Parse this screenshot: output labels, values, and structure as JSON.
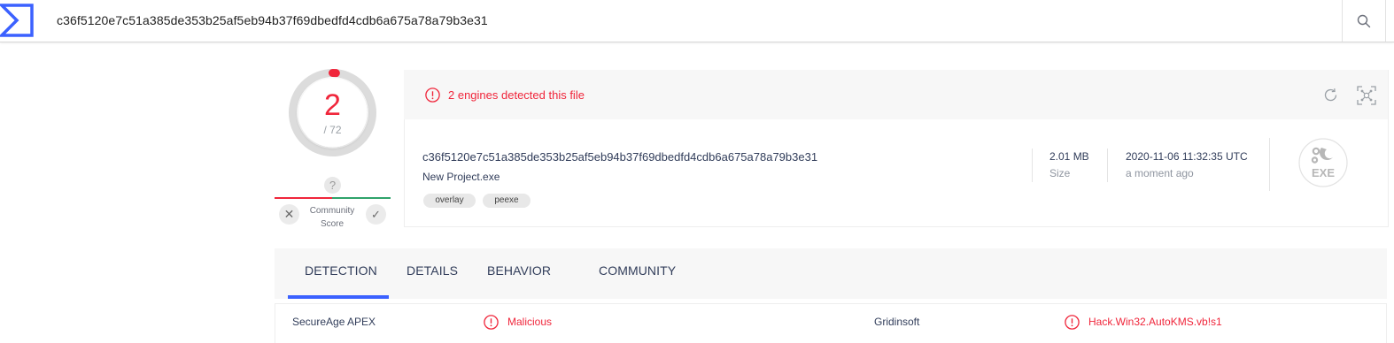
{
  "search": {
    "query": "c36f5120e7c51a385de353b25af5eb94b37f69dbedfd4cdb6a675a78a79b3e31"
  },
  "score": {
    "detections": "2",
    "total": "/ 72",
    "detection_fraction": 0.0278
  },
  "community": {
    "unknown_symbol": "?",
    "label_line1": "Community",
    "label_line2": "Score",
    "downvote_symbol": "✕",
    "upvote_symbol": "✓"
  },
  "summary": {
    "alert_text": "2 engines detected this file",
    "hash": "c36f5120e7c51a385de353b25af5eb94b37f69dbedfd4cdb6a675a78a79b3e31",
    "filename": "New Project.exe",
    "tags": [
      "overlay",
      "peexe"
    ],
    "size_value": "2.01 MB",
    "size_label": "Size",
    "date_value": "2020-11-06 11:32:35 UTC",
    "date_relative": "a moment ago",
    "file_type": "EXE"
  },
  "tabs": [
    {
      "label": "DETECTION",
      "active": true
    },
    {
      "label": "DETAILS",
      "active": false
    },
    {
      "label": "BEHAVIOR",
      "active": false
    },
    {
      "label": "COMMUNITY",
      "active": false
    }
  ],
  "detections": [
    {
      "engine": "SecureAge APEX",
      "result": "Malicious"
    },
    {
      "engine": "Gridinsoft",
      "result": "Hack.Win32.AutoKMS.vb!s1"
    }
  ],
  "colors": {
    "accent_blue": "#3b61ff",
    "malicious_red": "#f0263b",
    "harmless_green": "#2fa36b"
  }
}
